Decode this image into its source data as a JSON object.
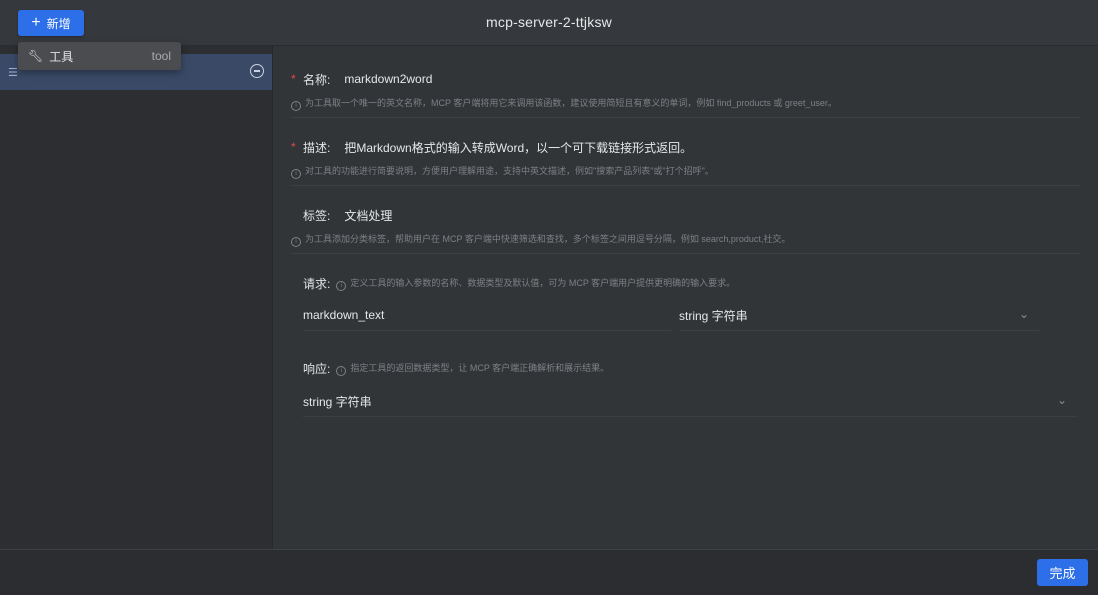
{
  "window": {
    "title": "mcp-server-2-ttjksw"
  },
  "toolbar": {
    "add_label": "新增",
    "add_icon": "plus-icon"
  },
  "dropdown": {
    "item_label": "工具",
    "item_kind": "tool",
    "item_icon": "wrench-icon"
  },
  "sidebar": {
    "items": [
      {
        "icon": "list-icon",
        "action_icon": "minus-circle-icon"
      }
    ]
  },
  "form": {
    "name": {
      "label": "名称:",
      "value": "markdown2word",
      "help": "为工具取一个唯一的英文名称，MCP 客户端将用它来调用该函数，建议使用简短且有意义的单词，例如 find_products 或 greet_user。"
    },
    "description": {
      "label": "描述:",
      "value": "把Markdown格式的输入转成Word，以一个可下载链接形式返回。",
      "help": "对工具的功能进行简要说明，方便用户理解用途，支持中英文描述，例如\"搜索产品列表\"或\"打个招呼\"。"
    },
    "tags": {
      "label": "标签:",
      "value": "文档处理",
      "help": "为工具添加分类标签，帮助用户在 MCP 客户端中快速筛选和查找，多个标签之间用逗号分隔，例如 search,product,社交。"
    },
    "request": {
      "label": "请求:",
      "help": "定义工具的输入参数的名称、数据类型及默认值，可为 MCP 客户端用户提供更明确的输入要求。",
      "param_name": "markdown_text",
      "param_type": "string 字符串"
    },
    "response": {
      "label": "响应:",
      "help": "指定工具的返回数据类型，让 MCP 客户端正确解析和展示结果。",
      "type": "string 字符串"
    }
  },
  "footer": {
    "done_label": "完成"
  },
  "colors": {
    "accent": "#2d6fe8",
    "required": "#e04a4a",
    "selected": "#3a4a66"
  }
}
